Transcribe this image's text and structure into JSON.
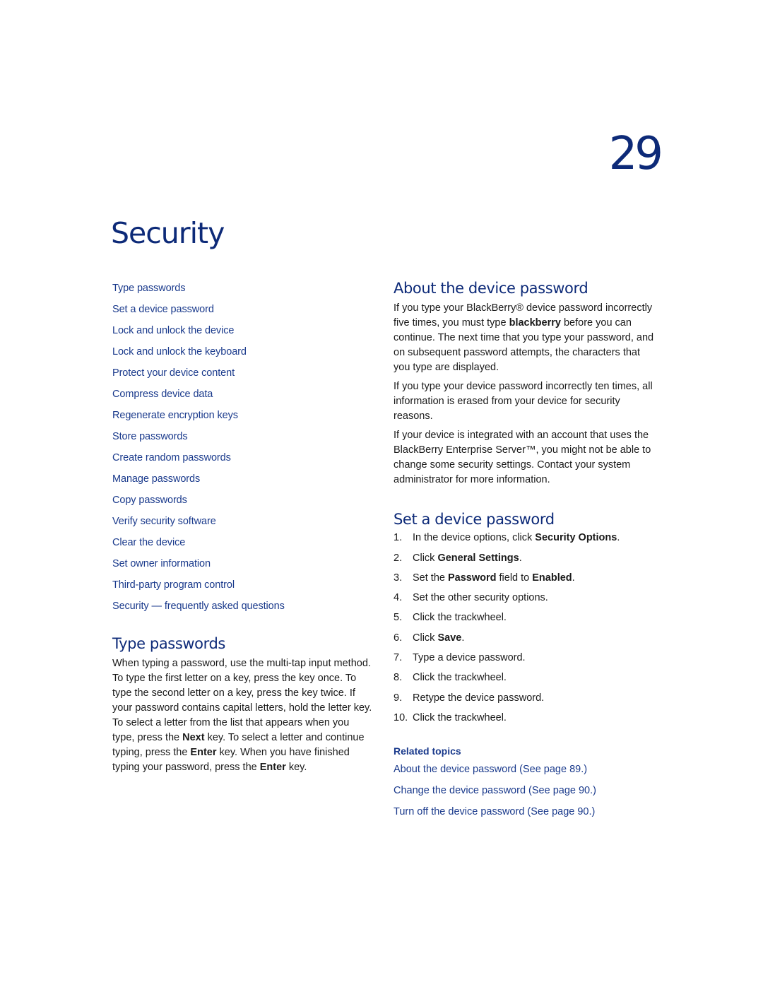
{
  "chapter_number": "29",
  "page_title": "Security",
  "toc": [
    "Type passwords",
    "Set a device password",
    "Lock and unlock the device",
    "Lock and unlock the keyboard",
    "Protect your device content",
    "Compress device data",
    "Regenerate encryption keys",
    "Store passwords",
    "Create random passwords",
    "Manage passwords",
    "Copy passwords",
    "Verify security software",
    "Clear the device",
    "Set owner information",
    "Third-party program control",
    "Security — frequently asked questions"
  ],
  "type_passwords": {
    "heading": "Type passwords",
    "body": [
      {
        "t": "When typing a password, use the multi-tap input method. To type the first letter on a key, press the key once. To type the second letter on a key, press the key twice. If your password contains capital letters, hold the letter key. To select a letter from the list that appears when you type, press the "
      },
      {
        "b": "Next"
      },
      {
        "t": " key. To select a letter and continue typing, press the "
      },
      {
        "b": "Enter"
      },
      {
        "t": " key. When you have finished typing your password, press the "
      },
      {
        "b": "Enter"
      },
      {
        "t": " key."
      }
    ]
  },
  "about_device_password": {
    "heading": "About the device password",
    "paragraphs": [
      [
        {
          "t": "If you type your BlackBerry® device password incorrectly five times, you must type "
        },
        {
          "b": "blackberry"
        },
        {
          "t": " before you can continue. The next time that you type your password, and on subsequent password attempts, the characters that you type are displayed."
        }
      ],
      [
        {
          "t": "If you type your device password incorrectly ten times, all information is erased from your device for security reasons."
        }
      ],
      [
        {
          "t": "If your device is integrated with an account that uses the BlackBerry Enterprise Server™, you might not be able to change some security settings. Contact your system administrator for more information."
        }
      ]
    ]
  },
  "set_device_password": {
    "heading": "Set a device password",
    "steps": [
      {
        "num": "1.",
        "parts": [
          {
            "t": "In the device options, click "
          },
          {
            "b": "Security Options"
          },
          {
            "t": "."
          }
        ]
      },
      {
        "num": "2.",
        "parts": [
          {
            "t": "Click "
          },
          {
            "b": "General Settings"
          },
          {
            "t": "."
          }
        ]
      },
      {
        "num": "3.",
        "parts": [
          {
            "t": "Set the "
          },
          {
            "b": "Password"
          },
          {
            "t": " field to "
          },
          {
            "b": "Enabled"
          },
          {
            "t": "."
          }
        ]
      },
      {
        "num": "4.",
        "parts": [
          {
            "t": "Set the other security options."
          }
        ]
      },
      {
        "num": "5.",
        "parts": [
          {
            "t": "Click the trackwheel."
          }
        ]
      },
      {
        "num": "6.",
        "parts": [
          {
            "t": "Click "
          },
          {
            "b": "Save"
          },
          {
            "t": "."
          }
        ]
      },
      {
        "num": "7.",
        "parts": [
          {
            "t": "Type a device password."
          }
        ]
      },
      {
        "num": "8.",
        "parts": [
          {
            "t": "Click the trackwheel."
          }
        ]
      },
      {
        "num": "9.",
        "parts": [
          {
            "t": "Retype the device password."
          }
        ]
      },
      {
        "num": "10.",
        "parts": [
          {
            "t": "Click the trackwheel."
          }
        ]
      }
    ]
  },
  "related_topics": {
    "title": "Related topics",
    "links": [
      "About the device password (See page 89.)",
      "Change the device password (See page 90.)",
      "Turn off the device password (See page 90.)"
    ]
  },
  "colors": {
    "heading": "#0d2a78",
    "link": "#1a3a8c",
    "body_text": "#1a1a1a"
  }
}
